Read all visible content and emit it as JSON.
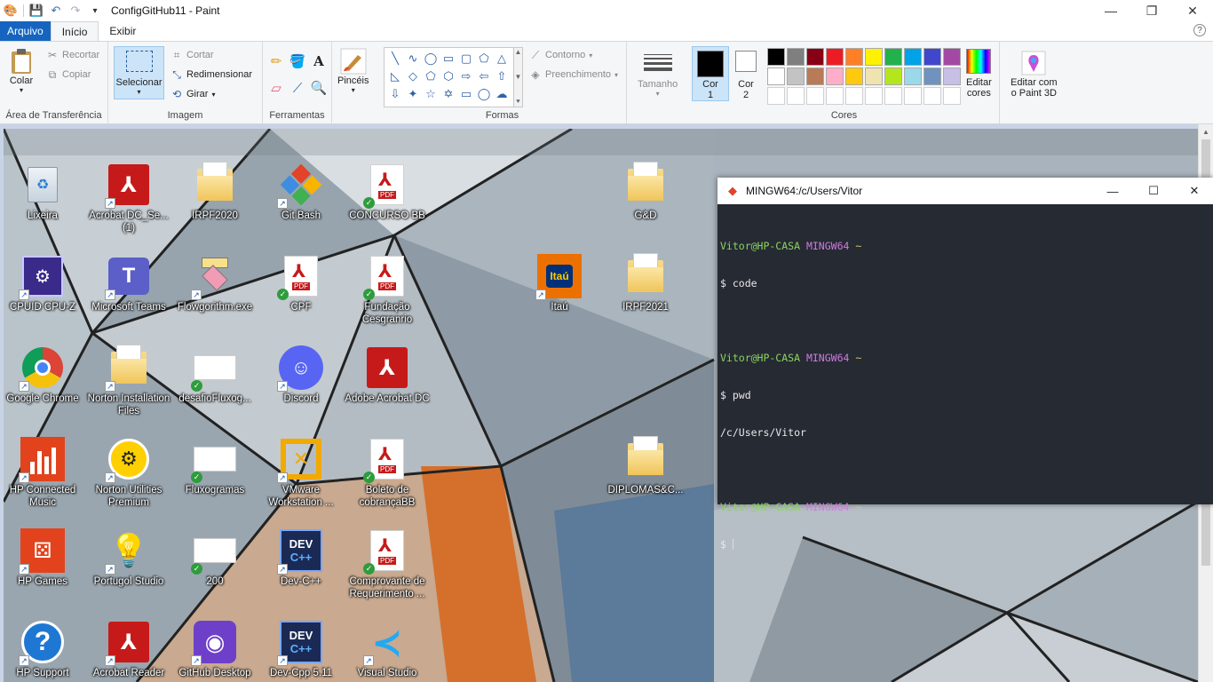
{
  "window": {
    "title": "ConfigGitHub11 - Paint",
    "minimize": "—",
    "maximize": "❐",
    "close": "✕"
  },
  "tabs": [
    {
      "label": "Arquivo"
    },
    {
      "label": "Início"
    },
    {
      "label": "Exibir"
    }
  ],
  "help": "?",
  "ribbon": {
    "clipboard": {
      "group_label": "Área de Transferência",
      "paste": "Colar",
      "cut": "Recortar",
      "copy": "Copiar"
    },
    "image": {
      "group_label": "Imagem",
      "select": "Selecionar",
      "crop": "Cortar",
      "resize": "Redimensionar",
      "rotate": "Girar"
    },
    "tools": {
      "group_label": "Ferramentas",
      "brushes": "Pincéis"
    },
    "shapes": {
      "group_label": "Formas",
      "outline": "Contorno",
      "fill": "Preenchimento",
      "size": "Tamanho"
    },
    "colors": {
      "group_label": "Cores",
      "color1_line1": "Cor",
      "color1_line2": "1",
      "color2_line1": "Cor",
      "color2_line2": "2",
      "edit_line1": "Editar",
      "edit_line2": "cores",
      "paint3d_line1": "Editar com",
      "paint3d_line2": "o Paint 3D",
      "color1": "#000000",
      "color2": "#ffffff",
      "palette": [
        "#000000",
        "#7f7f7f",
        "#880015",
        "#ed1c24",
        "#ff7f27",
        "#fff200",
        "#22b14c",
        "#00a2e8",
        "#3f48cc",
        "#a349a4",
        "#ffffff",
        "#c3c3c3",
        "#b97a57",
        "#ffaec9",
        "#ffc90e",
        "#efe4b0",
        "#b5e61d",
        "#99d9ea",
        "#7092be",
        "#c8bfe7"
      ]
    }
  },
  "desktop_icons": [
    {
      "label": "Lixeira"
    },
    {
      "label": "Acrobat DC_Se... (1)"
    },
    {
      "label": "IRPF2020"
    },
    {
      "label": "Git Bash"
    },
    {
      "label": "CONCURSO BB"
    },
    {
      "label": "G&D"
    },
    {
      "label": "CPUID CPU-Z"
    },
    {
      "label": "Microsoft Teams"
    },
    {
      "label": "Flowgorithm.exe"
    },
    {
      "label": "CPF"
    },
    {
      "label": "Fundação Cesgranrio"
    },
    {
      "label": "Itaú"
    },
    {
      "label": "IRPF2021"
    },
    {
      "label": "Google Chrome"
    },
    {
      "label": "Norton Installation Files"
    },
    {
      "label": "desafioFluxog..."
    },
    {
      "label": "Discord"
    },
    {
      "label": "Adobe Acrobat DC"
    },
    {
      "label": "HP Connected Music"
    },
    {
      "label": "Norton Utilities Premium"
    },
    {
      "label": "Fluxogramas"
    },
    {
      "label": "VMware Workstation ..."
    },
    {
      "label": "Boleto de cobrançaBB"
    },
    {
      "label": "DIPLOMAS&C..."
    },
    {
      "label": "HP Games"
    },
    {
      "label": "Portugol Studio"
    },
    {
      "label": "200"
    },
    {
      "label": "Dev-C++"
    },
    {
      "label": "Comprovante de Requerimento ..."
    },
    {
      "label": "HP Support"
    },
    {
      "label": "Acrobat Reader"
    },
    {
      "label": "GitHub Desktop"
    },
    {
      "label": "Dev-Cpp 5.11"
    },
    {
      "label": "Visual Studio"
    }
  ],
  "terminal": {
    "title": "MINGW64:/c/Users/Vitor",
    "user_host": "Vitor@HP-CASA",
    "env": "MINGW64",
    "path": "~",
    "cmd1": "$ code",
    "cmd2": "$ pwd",
    "out2": "/c/Users/Vitor",
    "cmd3": "$ "
  }
}
